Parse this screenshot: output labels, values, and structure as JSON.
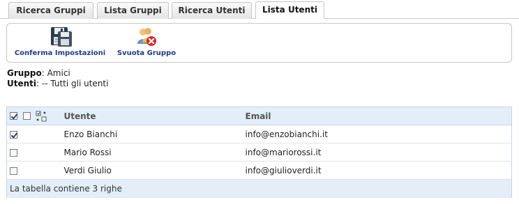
{
  "tabs": [
    {
      "label": "Ricerca Gruppi",
      "active": false
    },
    {
      "label": "Lista Gruppi",
      "active": false
    },
    {
      "label": "Ricerca Utenti",
      "active": false
    },
    {
      "label": "Lista Utenti",
      "active": true
    }
  ],
  "toolbar": {
    "save_label": "Conferma Impostazioni",
    "save_icon": "floppy-disk-icon",
    "empty_label": "Svuota Gruppo",
    "empty_icon": "users-remove-icon"
  },
  "info": {
    "group_label": "Gruppo",
    "group_value": ": Amici",
    "users_label": "Utenti",
    "users_value": ": -- Tutti gli utenti"
  },
  "table": {
    "columns": [
      "Utente",
      "Email"
    ],
    "rows": [
      {
        "checked": true,
        "name": "Enzo Bianchi",
        "email": "info@enzobianchi.it"
      },
      {
        "checked": false,
        "name": "Mario Rossi",
        "email": "info@mariorossi.it"
      },
      {
        "checked": false,
        "name": "Verdi Giulio",
        "email": "info@giulioverdi.it"
      }
    ],
    "footer": "La tabella contiene 3 righe"
  },
  "colors": {
    "header_bg": "#e3eef8",
    "link_blue": "#1f3b8a"
  }
}
